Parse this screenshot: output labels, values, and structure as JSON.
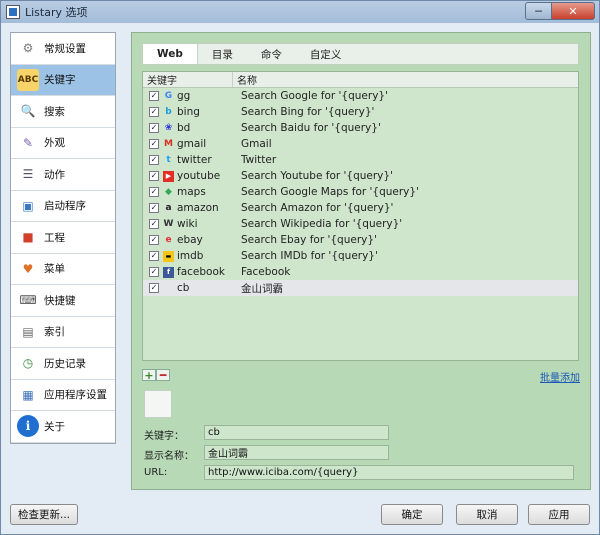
{
  "window": {
    "title": "Listary 选项",
    "close_glyph": "✕",
    "min_glyph": "─"
  },
  "sidebar": {
    "items": [
      {
        "label": "常规设置",
        "icon": "gear-icon",
        "glyph": "⚙",
        "color": "#7a7a7a"
      },
      {
        "label": "关键字",
        "icon": "abc-icon",
        "glyph": "ABC",
        "color": "#d48a1a",
        "active": true
      },
      {
        "label": "搜索",
        "icon": "magnifier-icon",
        "glyph": "🔍",
        "color": "#2f6fbf"
      },
      {
        "label": "外观",
        "icon": "palette-icon",
        "glyph": "✎",
        "color": "#7a5db0"
      },
      {
        "label": "动作",
        "icon": "list-icon",
        "glyph": "☰",
        "color": "#556"
      },
      {
        "label": "启动程序",
        "icon": "window-icon",
        "glyph": "▣",
        "color": "#3a78c0"
      },
      {
        "label": "工程",
        "icon": "cubes-icon",
        "glyph": "■",
        "color": "#d0402a"
      },
      {
        "label": "菜单",
        "icon": "heart-menu-icon",
        "glyph": "♥",
        "color": "#e0702a"
      },
      {
        "label": "快捷键",
        "icon": "keyboard-icon",
        "glyph": "⌨",
        "color": "#555"
      },
      {
        "label": "索引",
        "icon": "keyboard-index-icon",
        "glyph": "▤",
        "color": "#666"
      },
      {
        "label": "历史记录",
        "icon": "clock-icon",
        "glyph": "◷",
        "color": "#3a8a3a"
      },
      {
        "label": "应用程序设置",
        "icon": "app-window-icon",
        "glyph": "▦",
        "color": "#3a6fb8"
      },
      {
        "label": "关于",
        "icon": "info-icon",
        "glyph": "i",
        "color": "#1f6fd0"
      }
    ]
  },
  "tabs": [
    {
      "label": "Web",
      "active": true
    },
    {
      "label": "目录"
    },
    {
      "label": "命令"
    },
    {
      "label": "自定义"
    }
  ],
  "table": {
    "headers": {
      "keyword": "关键字",
      "name": "名称"
    },
    "check_glyph": "✓",
    "rows": [
      {
        "kw": "gg",
        "name": "Search Google for '{query}'",
        "icon": "google-icon",
        "glyph": "G",
        "color": "#4285f4"
      },
      {
        "kw": "bing",
        "name": "Search Bing for '{query}'",
        "icon": "bing-icon",
        "glyph": "b",
        "color": "#1f9bd8"
      },
      {
        "kw": "bd",
        "name": "Search Baidu for '{query}'",
        "icon": "baidu-icon",
        "glyph": "❀",
        "color": "#2932e1"
      },
      {
        "kw": "gmail",
        "name": "Gmail",
        "icon": "gmail-icon",
        "glyph": "M",
        "color": "#d93025"
      },
      {
        "kw": "twitter",
        "name": "Twitter",
        "icon": "twitter-icon",
        "glyph": "t",
        "color": "#1da1f2"
      },
      {
        "kw": "youtube",
        "name": "Search Youtube for '{query}'",
        "icon": "youtube-icon",
        "glyph": "▶",
        "color": "#e52d27"
      },
      {
        "kw": "maps",
        "name": "Search Google Maps for '{query}'",
        "icon": "maps-icon",
        "glyph": "◆",
        "color": "#34a853"
      },
      {
        "kw": "amazon",
        "name": "Search Amazon for '{query}'",
        "icon": "amazon-icon",
        "glyph": "a",
        "color": "#222222"
      },
      {
        "kw": "wiki",
        "name": "Search Wikipedia for '{query}'",
        "icon": "wikipedia-icon",
        "glyph": "W",
        "color": "#333333"
      },
      {
        "kw": "ebay",
        "name": "Search Ebay for '{query}'",
        "icon": "ebay-icon",
        "glyph": "e",
        "color": "#e53238"
      },
      {
        "kw": "imdb",
        "name": "Search IMDb for '{query}'",
        "icon": "imdb-icon",
        "glyph": "▬",
        "color": "#c8a200"
      },
      {
        "kw": "facebook",
        "name": "Facebook",
        "icon": "facebook-icon",
        "glyph": "f",
        "color": "#3b5998"
      },
      {
        "kw": "cb",
        "name": "金山词霸",
        "icon": "blank-icon",
        "glyph": "",
        "color": "#999999",
        "selected": true
      }
    ]
  },
  "controls": {
    "add_glyph": "+",
    "remove_glyph": "━",
    "bulk_add": "批量添加"
  },
  "form": {
    "keyword_label": "关键字：",
    "keyword_value": "cb",
    "display_label": "显示名称：",
    "display_value": "金山词霸",
    "url_label": "URL:",
    "url_value": "http://www.iciba.com/{query}"
  },
  "buttons": {
    "check_update": "检查更新...",
    "ok": "确定",
    "cancel": "取消",
    "apply": "应用"
  }
}
